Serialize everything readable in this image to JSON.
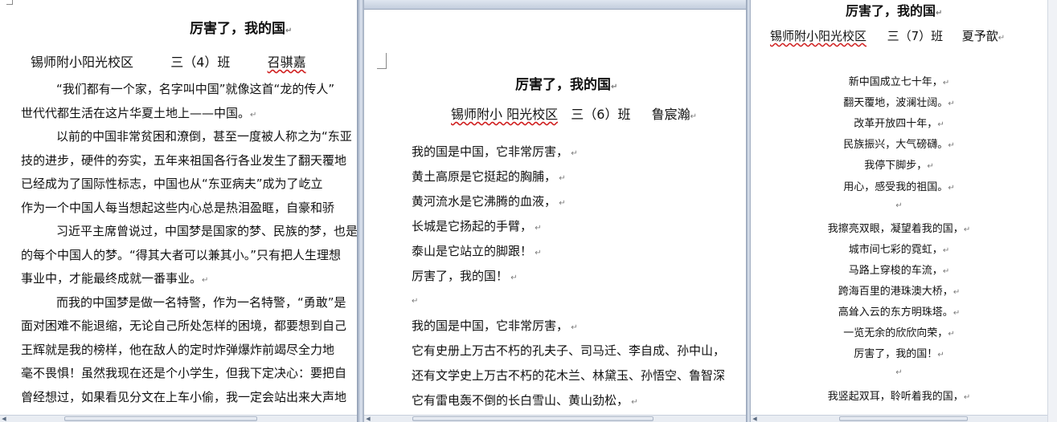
{
  "left": {
    "title": "厉害了，我的国",
    "author_school": "锡师附小阳光校区",
    "author_class": "三（4）班",
    "author_name": "召骐嘉",
    "lines": [
      "“我们都有一个家，名字叫中国”就像这首“龙的传人”",
      "世代代都生活在这片华夏土地上——中国。",
      "以前的中国非常贫困和潦倒，甚至一度被人称之为“东亚",
      "技的进步，硬件的夯实，五年来祖国各行各业发生了翻天覆地",
      "已经成为了国际性标志，中国也从“东亚病夫”成为了屹立",
      "作为一个中国人每当想起这些内心总是热泪盈眶，自豪和骄",
      "习近平主席曾说过，中国梦是国家的梦、民族的梦，也是",
      "的每个中国人的梦。“得其大者可以兼其小。”只有把人生理想",
      "事业中，才能最终成就一番事业。",
      "而我的中国梦是做一名特警，作为一名特警，“勇敢”是",
      "面对困难不能退缩，无论自己所处怎样的困境，都要想到自己",
      "王辉就是我的榜样，他在敌人的定时炸弹爆炸前竭尽全力地",
      "毫不畏惧！虽然我现在还是个小学生，但我下定决心：要把自",
      "曾经想过，如果看见分文在上车小偷，我一定会站出来大声地"
    ]
  },
  "middle": {
    "title": "厉害了，我的国",
    "author_school": "锡师附小 阳光校区",
    "author_class": "三（6）班",
    "author_name": "鲁宸瀚",
    "lines": [
      "我的国是中国，它非常厉害，",
      "黄土高原是它挺起的胸脯，",
      "黄河流水是它沸腾的血液，",
      "长城是它扬起的手臂，",
      "泰山是它站立的脚跟！",
      "厉害了，我的国！",
      "",
      "我的国是中国，它非常厉害，",
      "它有史册上万古不朽的孔夫子、司马迁、李自成、孙中山，",
      "还有文学史上万古不朽的花木兰、林黛玉、孙悟空、鲁智深",
      "它有雷电轰不倒的长白雪山、黄山劲松，"
    ]
  },
  "right": {
    "title": "厉害了，我的国",
    "author_school": "锡师附小阳光校区",
    "author_class": "三（7）班",
    "author_name": "夏予歆",
    "lines": [
      "新中国成立七十年，",
      "翻天覆地，波澜壮阔。",
      "改革开放四十年，",
      "民族振兴，大气磅礴。",
      "我停下脚步，",
      "用心，感受我的祖国。",
      "",
      "我擦亮双眼，凝望着我的国，",
      "城市间七彩的霓虹，",
      "马路上穿梭的车流，",
      "跨海百里的港珠澳大桥，",
      "高耸入云的东方明珠塔。",
      "一览无余的欣欣向荣，",
      "厉害了，我的国！",
      "",
      "我竖起双耳，聆听着我的国，"
    ]
  }
}
